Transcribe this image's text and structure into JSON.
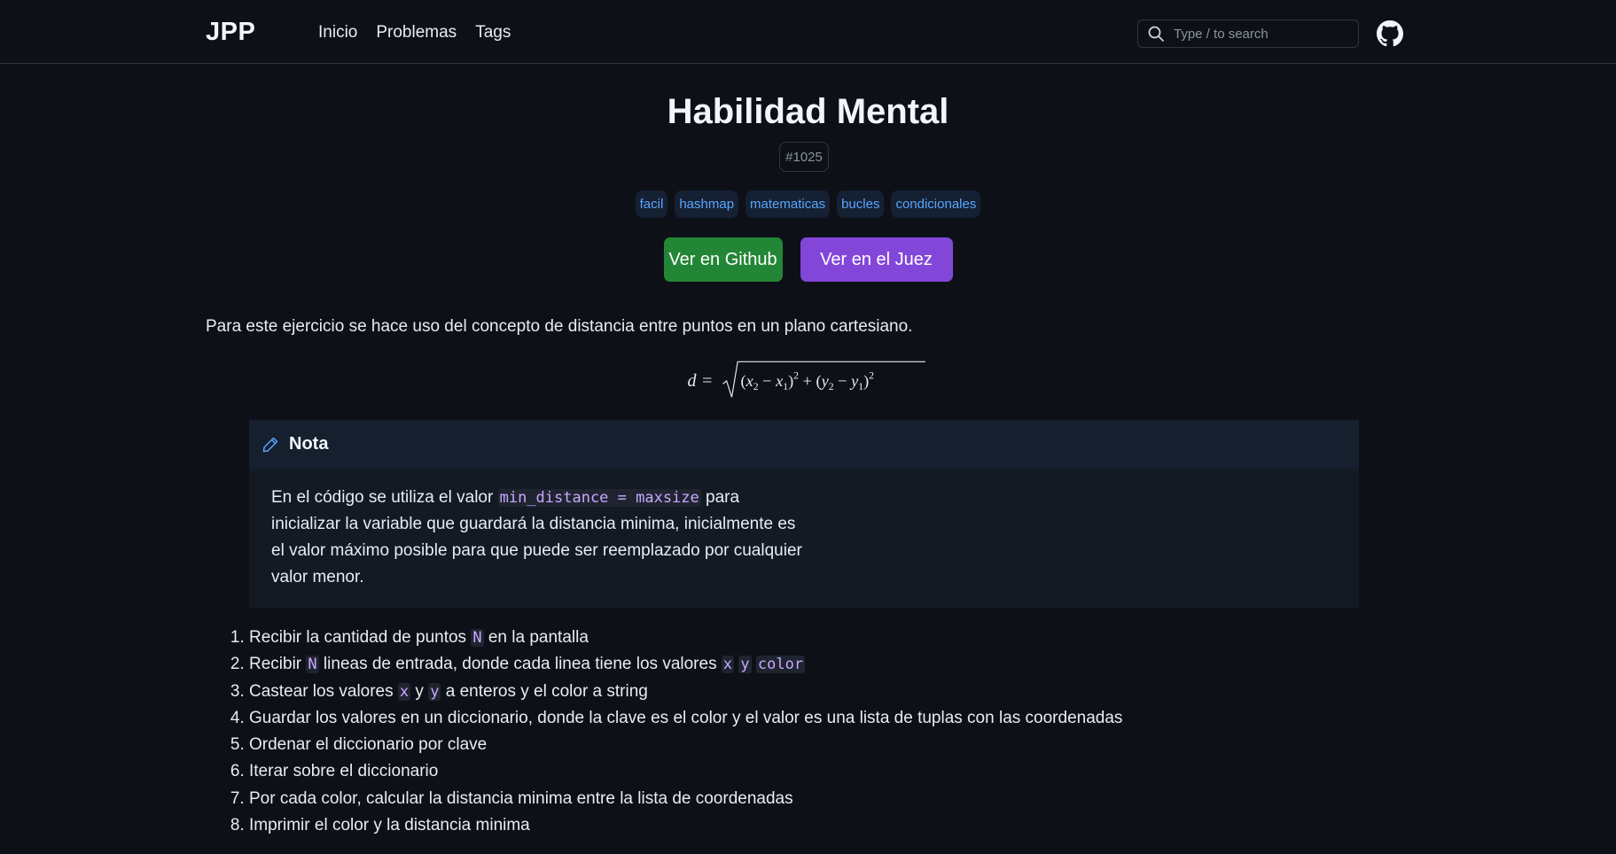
{
  "header": {
    "brand": "JPP",
    "nav": [
      "Inicio",
      "Problemas",
      "Tags"
    ],
    "search_placeholder": "Type / to search"
  },
  "problem": {
    "title": "Habilidad Mental",
    "id": "#1025",
    "tags": [
      "facil",
      "hashmap",
      "matematicas",
      "bucles",
      "condicionales"
    ],
    "buttons": {
      "github": "Ver en Github",
      "judge": "Ver en el Juez"
    },
    "intro": "Para este ejercicio se hace uso del concepto de distancia entre puntos en un plano cartesiano.",
    "formula": "d = √((x2 − x1)² + (y2 − y1)²)"
  },
  "note": {
    "title": "Nota",
    "text_before": "En el código se utiliza el valor ",
    "code": "min_distance = maxsize",
    "text_after": " para inicializar la variable que guardará la distancia minima, inicialmente es el valor máximo posible para que puede ser reemplazado por cualquier valor menor."
  },
  "steps": [
    [
      "Recibir la cantidad de puntos ",
      {
        "code": "N"
      },
      " en la pantalla"
    ],
    [
      "Recibir ",
      {
        "code": "N"
      },
      " lineas de entrada, donde cada linea tiene los valores ",
      {
        "code": "x"
      },
      " ",
      {
        "code": "y"
      },
      " ",
      {
        "code": "color"
      }
    ],
    [
      "Castear los valores ",
      {
        "code": "x"
      },
      " y ",
      {
        "code": "y"
      },
      " a enteros y el color a string"
    ],
    [
      "Guardar los valores en un diccionario, donde la clave es el color y el valor es una lista de tuplas con las coordenadas"
    ],
    [
      "Ordenar el diccionario por clave"
    ],
    [
      "Iterar sobre el diccionario"
    ],
    [
      "Por cada color, calcular la distancia minima entre la lista de coordenadas"
    ],
    [
      "Imprimir el color y la distancia minima"
    ]
  ],
  "colors": {
    "background": "#0d1117",
    "tag_bg": "#162033",
    "tag_text": "#58a6ff",
    "github_button": "#238636",
    "judge_button": "#8247d9",
    "note_header": "#161f2e",
    "code_text": "#c8a8ff"
  }
}
